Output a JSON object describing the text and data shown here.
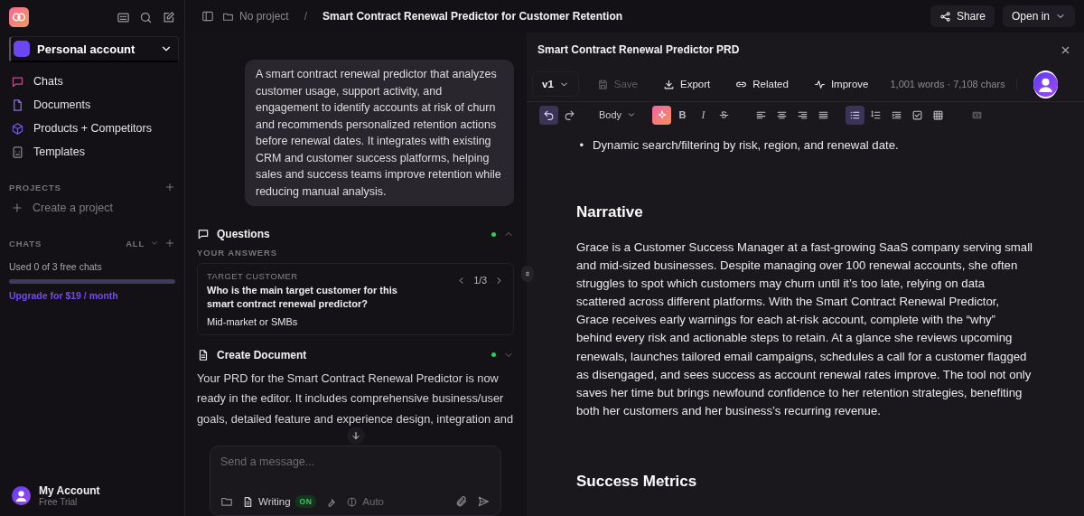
{
  "sidebar": {
    "account": "Personal account",
    "nav": [
      {
        "label": "Chats",
        "kind": "chats"
      },
      {
        "label": "Documents",
        "kind": "documents"
      },
      {
        "label": "Products + Competitors",
        "kind": "products"
      },
      {
        "label": "Templates",
        "kind": "templates"
      }
    ],
    "projects": {
      "heading": "PROJECTS",
      "create": "Create a project"
    },
    "chats": {
      "heading": "CHATS",
      "filter": "ALL",
      "usage": "Used 0 of 3 free chats",
      "level": 0,
      "upgrade": "Upgrade for $19 / month"
    },
    "user": {
      "name": "My Account",
      "plan": "Free Trial"
    }
  },
  "topbar": {
    "project": "No project",
    "separator": "/",
    "title": "Smart Contract Renewal Predictor for Customer Retention",
    "share": "Share",
    "open_in": "Open in"
  },
  "chat": {
    "message": "A smart contract renewal predictor that analyzes customer usage, support activity, and engagement to identify accounts at risk of churn and recommends personalized retention actions before renewal dates. It integrates with existing CRM and customer success platforms, helping sales and success teams improve retention while reducing manual analysis.",
    "sections": [
      {
        "kind": "questions",
        "title": "Questions",
        "expanded": true,
        "label": "YOUR ANSWERS",
        "card": {
          "category": "TARGET CUSTOMER",
          "question": "Who is the main target customer for this smart contract renewal predictor?",
          "answer": "Mid-market or SMBs",
          "pager": "1/3"
        }
      },
      {
        "kind": "document",
        "title": "Create Document",
        "expanded": false,
        "text": "Your PRD for the Smart Contract Renewal Predictor is now ready in the editor. It includes comprehensive business/user goals, detailed feature and experience design, integration and"
      }
    ],
    "composer": {
      "placeholder": "Send a message...",
      "writing": "Writing",
      "writing_badge": "ON",
      "mode": "Auto"
    }
  },
  "doc": {
    "title": "Smart Contract Renewal Predictor PRD",
    "version": "v1",
    "actions": [
      {
        "kind": "save",
        "label": "Save",
        "disabled": true
      },
      {
        "kind": "export",
        "label": "Export",
        "disabled": false
      },
      {
        "kind": "related",
        "label": "Related",
        "disabled": false
      },
      {
        "kind": "improve",
        "label": "Improve",
        "disabled": false
      }
    ],
    "stats": "1,001 words · 7,108 chars",
    "toolbar": [
      {
        "kind": "undo",
        "on": true
      },
      {
        "kind": "redo",
        "on": false
      },
      {
        "kind": "style",
        "label": "Body",
        "on": false
      },
      {
        "kind": "ai",
        "on": false
      },
      {
        "kind": "bold",
        "label": "B",
        "on": false
      },
      {
        "kind": "italic",
        "label": "I",
        "on": false
      },
      {
        "kind": "strike",
        "on": false
      },
      {
        "kind": "align-left",
        "on": false
      },
      {
        "kind": "align-center",
        "on": false
      },
      {
        "kind": "align-right",
        "on": false
      },
      {
        "kind": "justify",
        "on": false
      },
      {
        "kind": "bullets",
        "on": true
      },
      {
        "kind": "numbers",
        "on": false
      },
      {
        "kind": "indent",
        "on": false
      },
      {
        "kind": "task",
        "on": false
      },
      {
        "kind": "table",
        "on": false
      },
      {
        "kind": "code",
        "on": false
      }
    ],
    "content": [
      {
        "kind": "bullet",
        "marker": "•",
        "text": "Dynamic search/filtering by risk, region, and renewal date."
      },
      {
        "kind": "heading",
        "text": "Narrative"
      },
      {
        "kind": "paragraph",
        "text": "Grace is a Customer Success Manager at a fast-growing SaaS company serving small and mid-sized businesses. Despite managing over 100 renewal accounts, she often struggles to spot which customers may churn until it’s too late, relying on data scattered across different platforms. With the Smart Contract Renewal Predictor, Grace receives early warnings for each at-risk account, complete with the “why” behind every risk and actionable steps to retain. At a glance she reviews upcoming renewals, launches tailored email campaigns, schedules a call for a customer flagged as disengaged, and sees success as account renewal rates improve. The tool not only saves her time but brings newfound confidence to her retention strategies, benefiting both her customers and her business’s recurring revenue."
      },
      {
        "kind": "heading",
        "text": "Success Metrics"
      }
    ]
  }
}
